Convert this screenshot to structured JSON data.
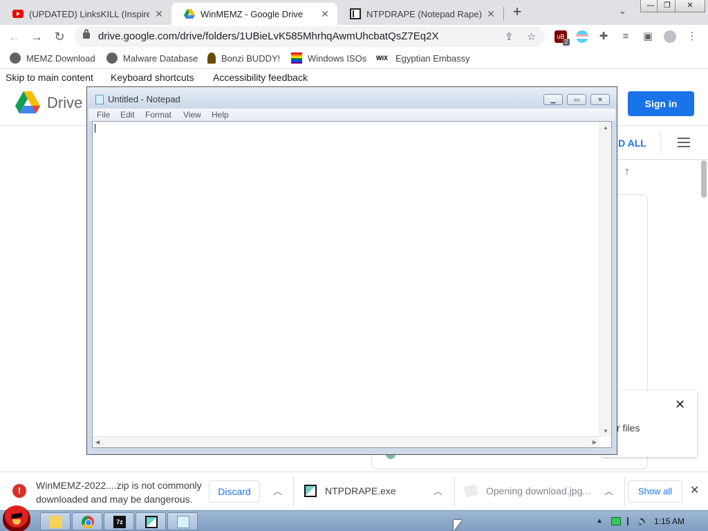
{
  "tabs": [
    {
      "title": "(UPDATED) LinksKILL (Inspired",
      "icon": "youtube-icon"
    },
    {
      "title": "WinMEMZ - Google Drive",
      "icon": "google-drive-icon"
    },
    {
      "title": "NTPDRAPE (Notepad Rape) : D",
      "icon": "book-icon"
    }
  ],
  "address": {
    "url": "drive.google.com/drive/folders/1UBieLvK585MhrhqAwmUhcbatQsZ7Eq2X"
  },
  "extensions": {
    "ublock_badge": "2"
  },
  "bookmarks": [
    {
      "label": "MEMZ Download"
    },
    {
      "label": "Malware Database"
    },
    {
      "label": "Bonzi BUDDY!"
    },
    {
      "label": "Windows ISOs"
    },
    {
      "label": "Egyptian Embassy",
      "icon_text": "WIX"
    }
  ],
  "drive": {
    "skip_links": [
      "Skip to main content",
      "Keyboard shortcuts",
      "Accessibility feedback"
    ],
    "logo_text": "Drive",
    "sign_in": "Sign in",
    "download_all": "AD ALL",
    "toast_text": "r files"
  },
  "notepad": {
    "title": "Untitled - Notepad",
    "menu": [
      "File",
      "Edit",
      "Format",
      "View",
      "Help"
    ]
  },
  "downloads": {
    "warning_text": "WinMEMZ-2022....zip is not commonly downloaded and may be dangerous.",
    "discard": "Discard",
    "file_name": "NTPDRAPE.exe",
    "opening_name": "Opening download.jpg...",
    "show_all": "Show all"
  },
  "taskbar": {
    "clock": "1:15 AM",
    "seven_zip_label": "7z"
  },
  "colors": {
    "accent": "#1a73e8",
    "tabstrip": "#dfe1e5",
    "danger": "#d93025"
  }
}
